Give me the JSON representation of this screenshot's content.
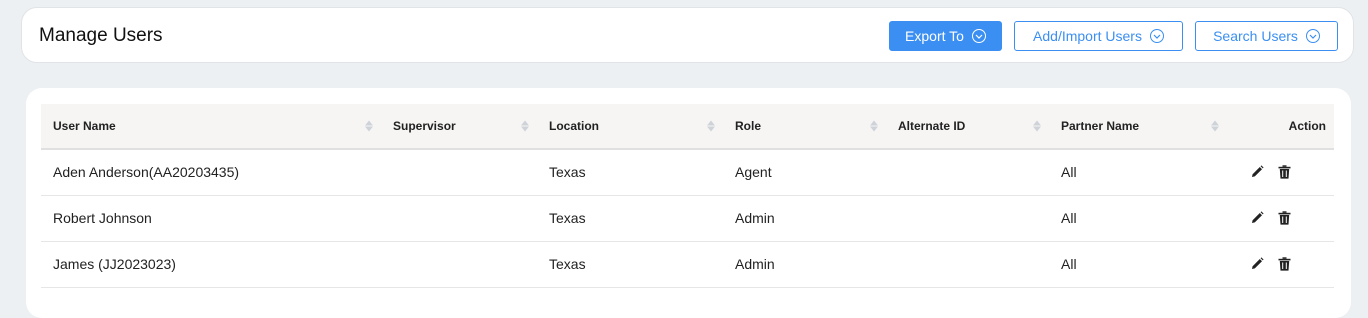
{
  "header": {
    "title": "Manage Users",
    "buttons": {
      "export": "Export To",
      "add_import": "Add/Import Users",
      "search": "Search Users"
    }
  },
  "table": {
    "columns": [
      "User Name",
      "Supervisor",
      "Location",
      "Role",
      "Alternate ID",
      "Partner Name",
      "Action"
    ],
    "rows": [
      {
        "user_name": "Aden Anderson(AA20203435)",
        "supervisor": "",
        "location": "Texas",
        "role": "Agent",
        "alternate_id": "",
        "partner_name": "All"
      },
      {
        "user_name": "Robert Johnson",
        "supervisor": "",
        "location": "Texas",
        "role": "Admin",
        "alternate_id": "",
        "partner_name": "All"
      },
      {
        "user_name": "James (JJ2023023)",
        "supervisor": "",
        "location": "Texas",
        "role": "Admin",
        "alternate_id": "",
        "partner_name": "All"
      }
    ],
    "action_icons": [
      "pencil-icon",
      "trash-icon"
    ]
  },
  "colors": {
    "accent": "#3b8ff2",
    "page_background": "#edf0f2",
    "header_row_background": "#f6f5f4"
  }
}
